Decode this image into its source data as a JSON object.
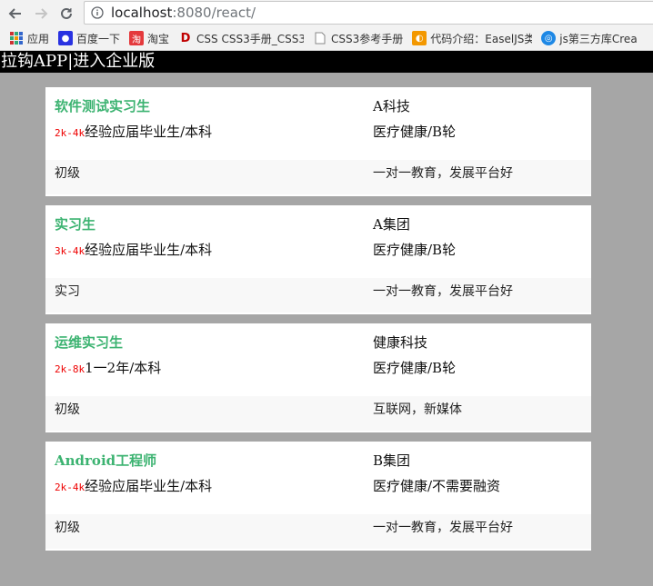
{
  "browser": {
    "url_host": "localhost",
    "url_path": ":8080/react/",
    "bookmarks": [
      {
        "label": "应用",
        "icon": "apps-grid-icon",
        "color": "#cc3333"
      },
      {
        "label": "百度一下",
        "icon": "baidu-paw-icon",
        "color": "#2932e1"
      },
      {
        "label": "淘宝",
        "icon": "taobao-icon",
        "color": "#e4393c"
      },
      {
        "label": "CSS CSS3手册_CSS3",
        "icon": "csdn-icon",
        "color": "#c00000"
      },
      {
        "label": "CSS3参考手册",
        "icon": "page-icon",
        "color": "#888888"
      },
      {
        "label": "代码介绍：EaselJS类",
        "icon": "code-icon",
        "color": "#f39800"
      },
      {
        "label": "js第三方库Crea",
        "icon": "globe-icon",
        "color": "#1e88e5"
      }
    ]
  },
  "header": {
    "title": "拉钩APP|进入企业版"
  },
  "jobs": [
    {
      "title": "软件测试实习生",
      "company": "A科技",
      "salary": "2k-4k",
      "requirement": "经验应届毕业生/本科",
      "industry": "医疗健康/B轮",
      "level": "初级",
      "benefit": "一对一教育，发展平台好"
    },
    {
      "title": "实习生",
      "company": "A集团",
      "salary": "3k-4k",
      "requirement": "经验应届毕业生/本科",
      "industry": "医疗健康/B轮",
      "level": "实习",
      "benefit": "一对一教育，发展平台好"
    },
    {
      "title": "运维实习生",
      "company": "健康科技",
      "salary": "2k-8k",
      "requirement": "1一2年/本科",
      "industry": "医疗健康/B轮",
      "level": "初级",
      "benefit": "互联网，新媒体"
    },
    {
      "title": "Android工程师",
      "company": "B集团",
      "salary": "2k-4k",
      "requirement": "经验应届毕业生/本科",
      "industry": "医疗健康/不需要融资",
      "level": "初级",
      "benefit": "一对一教育，发展平台好"
    }
  ],
  "colors": {
    "title_green": "#3cb371",
    "salary_red": "#e00000",
    "header_bg": "#000000",
    "page_bg": "#a6a6a6"
  }
}
